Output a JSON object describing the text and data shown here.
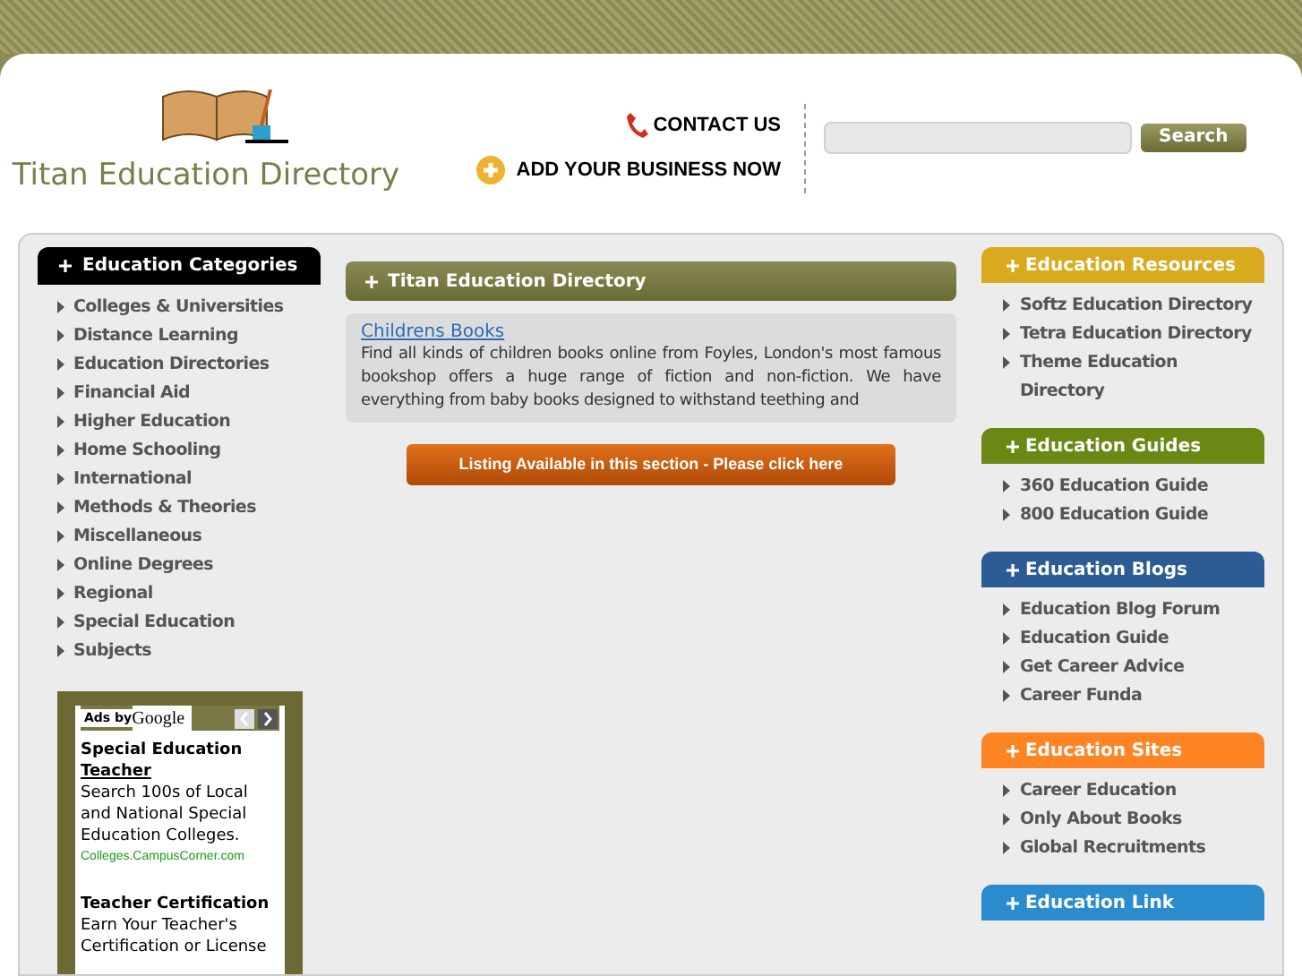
{
  "header": {
    "site_title": "Titan Education Directory",
    "contact": "CONTACT US",
    "add_business": "ADD YOUR BUSINESS NOW",
    "search": {
      "button": "Search"
    }
  },
  "categories": {
    "title": "Education Categories",
    "items": [
      "Colleges & Universities",
      "Distance Learning",
      "Education Directories",
      "Financial Aid",
      "Higher Education",
      "Home Schooling",
      "International",
      "Methods & Theories",
      "Miscellaneous",
      "Online Degrees",
      "Regional",
      "Special Education",
      "Subjects"
    ]
  },
  "ads": {
    "label": "Ads by",
    "brand": "Google",
    "items": [
      {
        "title": "Special Education",
        "link": "Teacher",
        "text": "Search 100s of Local and National Special Education Colleges.",
        "url": "Colleges.CampusCorner.com"
      },
      {
        "title": "Teacher Certification",
        "text": "Earn Your Teacher's Certification or License"
      }
    ]
  },
  "main": {
    "title": "Titan Education Directory",
    "listing": {
      "link": "Childrens Books",
      "text": "Find all kinds of children books online from Foyles, London's most famous bookshop offers a huge range of fiction and non-fiction. We have everything from baby books designed to withstand teething and"
    },
    "button": "Listing Available in this section - Please click here"
  },
  "sections": [
    {
      "title": "Education Resources",
      "color": "#d9aa1e",
      "items": [
        "Softz Education Directory",
        "Tetra Education Directory",
        "Theme Education Directory"
      ]
    },
    {
      "title": "Education Guides",
      "color": "#6b8714",
      "items": [
        "360 Education Guide",
        "800 Education Guide"
      ]
    },
    {
      "title": "Education Blogs",
      "color": "#2b5d94",
      "items": [
        "Education Blog Forum",
        "Education Guide",
        "Get Career Advice",
        "Career Funda"
      ]
    },
    {
      "title": "Education Sites",
      "color": "#ff8424",
      "items": [
        "Career Education",
        "Only About Books",
        "Global Recruitments"
      ]
    },
    {
      "title": "Education Link",
      "color": "#2a8ccc"
    }
  ]
}
